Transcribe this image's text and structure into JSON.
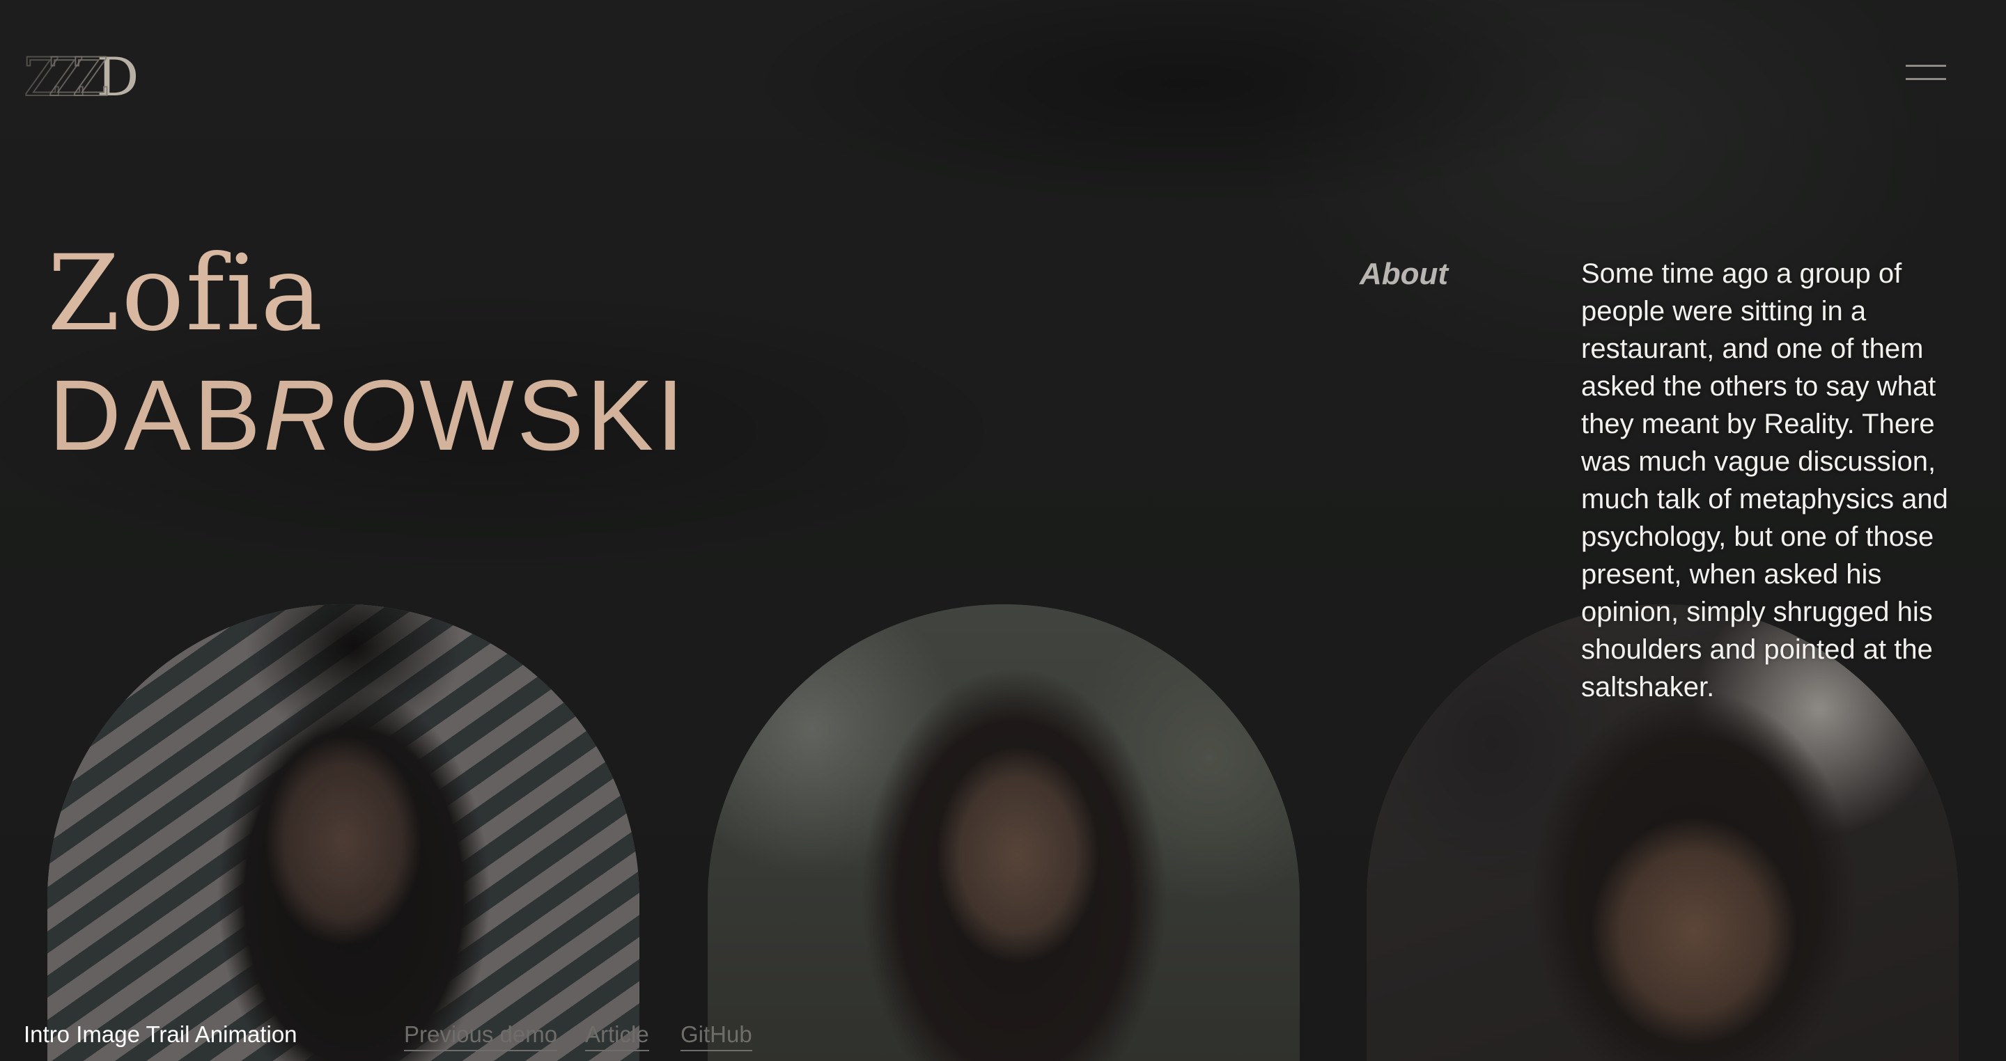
{
  "header": {
    "logo_letters": [
      "Z",
      "Z",
      "Z",
      "D"
    ],
    "menu_icon": "hamburger-menu-icon"
  },
  "hero": {
    "first_name": "Zofia",
    "last_name_start": "DAB",
    "last_name_italic": "RO",
    "last_name_end": "WSKI"
  },
  "about": {
    "label": "About",
    "text": "Some time ago a group of people were sitting in a restaurant, and one of them asked the others to say what they meant by Reality. There was much vague discussion, much talk of metaphysics and psychology, but one of those present, when asked his opinion, simply shrugged his shoulders and pointed at the saltshaker."
  },
  "gallery": {
    "items": [
      {
        "name": "portrait-1"
      },
      {
        "name": "portrait-2"
      },
      {
        "name": "portrait-3"
      }
    ]
  },
  "footer": {
    "title": "Intro Image Trail Animation",
    "links": {
      "previous": "Previous demo",
      "article": "Article",
      "github": "GitHub"
    }
  },
  "colors": {
    "background": "#1b1c1b",
    "accent": "#d8b8a1",
    "text": "#f2f1ee",
    "muted_link": "#6f6d6a"
  }
}
